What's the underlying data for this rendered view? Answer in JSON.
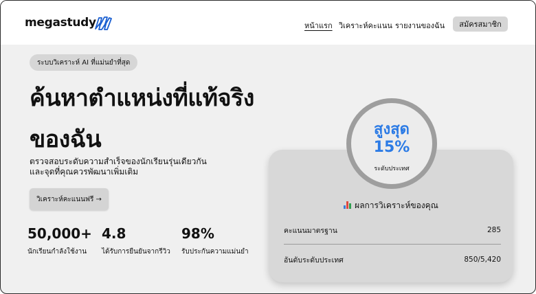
{
  "header": {
    "logo_text": "megastudy",
    "nav": [
      {
        "label": "หน้าแรก",
        "active": true
      },
      {
        "label": "วิเคราะห์คะแนน",
        "active": false
      },
      {
        "label": "รายงานของฉัน",
        "active": false
      }
    ],
    "signup_label": "สมัครสมาชิก"
  },
  "hero": {
    "pill": "ระบบวิเคราะห์ AI ที่แม่นยำที่สุด",
    "headline_line1": "ค้นหาตำแหน่งที่แท้จริง",
    "headline_line2": "ของฉัน",
    "sub_line1": "ตรวจสอบระดับความสำเร็จของนักเรียนรุ่นเดียวกัน",
    "sub_line2": "และจุดที่คุณควรพัฒนาเพิ่มเติม",
    "cta_label": "วิเคราะห์คะแนนฟรี →"
  },
  "stats": [
    {
      "value": "50,000+",
      "label": "นักเรียนกำลังใช้งาน"
    },
    {
      "value": "4.8",
      "label": "ได้รับการยืนยันจากรีวิว"
    },
    {
      "value": "98%",
      "label": "รับประกันความแม่นยำ"
    }
  ],
  "result": {
    "ring_top": "สูงสุด",
    "ring_pct": "15%",
    "ring_label": "ระดับประเทศ",
    "title": "ผลการวิเคราะห์ของคุณ",
    "rows": [
      {
        "label": "คะแนนมาตรฐาน",
        "value": "285"
      },
      {
        "label": "อันดับระดับประเทศ",
        "value": "850/5,420"
      }
    ]
  },
  "colors": {
    "accent": "#2c7be5",
    "logo_mark": "#1a5fd1",
    "background": "#f0f0f0",
    "card": "#d8d8d8",
    "ring": "#9e9e9e"
  },
  "icons": {
    "logo": "stylized-n-mark",
    "result_title": "bar-chart-icon",
    "cta": "arrow-right"
  }
}
